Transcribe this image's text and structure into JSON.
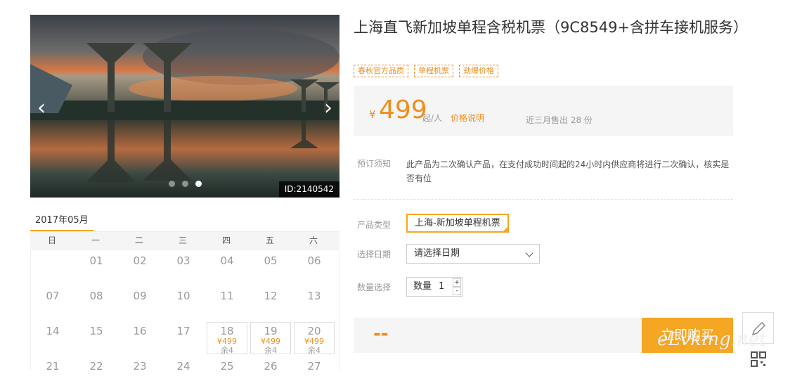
{
  "nav": {
    "items": [
      "",
      "",
      "",
      ""
    ]
  },
  "slider": {
    "image_id": "ID:2140542",
    "prev_symbol": "‹",
    "next_symbol": "›",
    "dot_count": 3,
    "active_dot": 3
  },
  "calendar": {
    "month": "2017年05月",
    "weekdays": [
      "日",
      "一",
      "二",
      "三",
      "四",
      "五",
      "六"
    ],
    "weeks": [
      [
        {
          "d": ""
        },
        {
          "d": "01"
        },
        {
          "d": "02"
        },
        {
          "d": "03"
        },
        {
          "d": "04"
        },
        {
          "d": "05"
        },
        {
          "d": "06"
        }
      ],
      [
        {
          "d": "07"
        },
        {
          "d": "08"
        },
        {
          "d": "09"
        },
        {
          "d": "10"
        },
        {
          "d": "11"
        },
        {
          "d": "12"
        },
        {
          "d": "13"
        }
      ],
      [
        {
          "d": "14"
        },
        {
          "d": "15"
        },
        {
          "d": "16"
        },
        {
          "d": "17"
        },
        {
          "d": "18",
          "price": "¥499",
          "remain": "余4"
        },
        {
          "d": "19",
          "price": "¥499",
          "remain": "余4"
        },
        {
          "d": "20",
          "price": "¥499",
          "remain": "余4"
        }
      ],
      [
        {
          "d": "21"
        },
        {
          "d": "22"
        },
        {
          "d": "23"
        },
        {
          "d": "24"
        },
        {
          "d": "25"
        },
        {
          "d": "26"
        },
        {
          "d": "27"
        }
      ]
    ]
  },
  "product": {
    "title": "上海直飞新加坡单程含税机票（9C8549+含拼车接机服务）",
    "tags": [
      "春秋官方品质",
      "单程机票",
      "劲爆价格"
    ],
    "price": {
      "currency": "¥",
      "amount": "499",
      "unit": "起/人",
      "note_link": "价格说明",
      "sold": "近三月售出 28 份"
    },
    "notice": {
      "label": "预订须知",
      "text": "此产品为二次确认产品，在支付成功时间起的24小时内供应商将进行二次确认，核实是否有位"
    },
    "type_label": "产品类型",
    "type_value": "上海-新加坡单程机票",
    "date_label": "选择日期",
    "date_placeholder": "请选择日期",
    "qty_label": "数量选择",
    "qty_text": "数量",
    "qty_value": "1",
    "qty_inc": "+",
    "qty_dec": "-",
    "total": "--",
    "buy_label": "立即购买"
  },
  "watermark": "eLvking.net",
  "colors": {
    "accent": "#f5a623",
    "price": "#f08d1c"
  },
  "icons": [
    "chevron-left-icon",
    "chevron-right-icon",
    "chevron-down-icon",
    "pencil-icon",
    "qrcode-icon"
  ]
}
